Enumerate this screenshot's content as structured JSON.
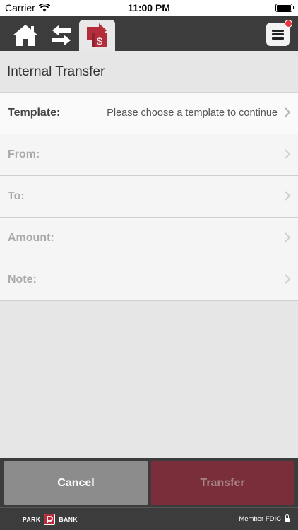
{
  "status_bar": {
    "carrier": "Carrier",
    "time": "11:00 PM"
  },
  "navbar": {
    "icons": [
      "home-icon",
      "transfer-arrows-icon",
      "internal-transfer-icon",
      "menu-icon"
    ],
    "active": "internal-transfer-icon",
    "has_notification": true
  },
  "page": {
    "title": "Internal Transfer"
  },
  "form": {
    "template": {
      "label": "Template:",
      "value": "Please choose a template to continue"
    },
    "from": {
      "label": "From:"
    },
    "to": {
      "label": "To:"
    },
    "amount": {
      "label": "Amount:"
    },
    "note": {
      "label": "Note:"
    }
  },
  "actions": {
    "cancel": "Cancel",
    "transfer": "Transfer"
  },
  "footer": {
    "brand_left": "PARK",
    "brand_right": "BANK",
    "member": "Member FDIC"
  },
  "colors": {
    "navbar": "#3c3c3c",
    "brand_red": "#b32d3a",
    "transfer_button": "#7a2e3a",
    "cancel_button": "#8c8c8c",
    "notification_dot": "#e8363f"
  }
}
